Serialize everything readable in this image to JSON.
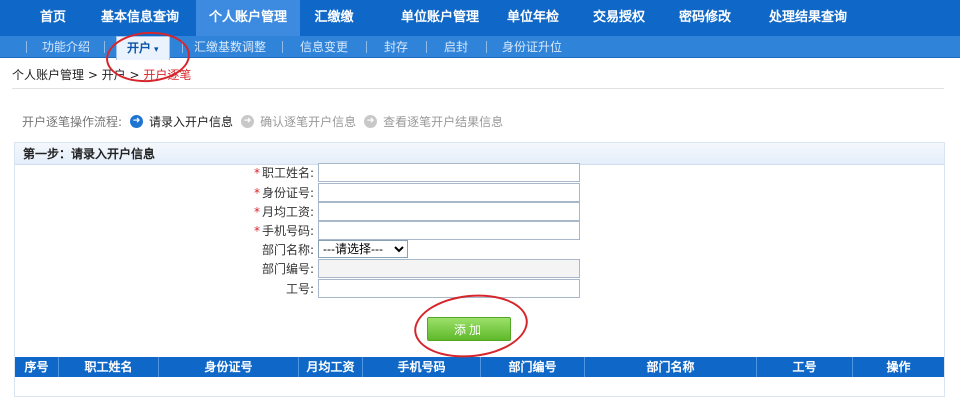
{
  "topnav": {
    "items": [
      "首页",
      "基本信息查询",
      "个人账户管理",
      "汇缴缴",
      "单位账户管理",
      "单位年检",
      "交易授权",
      "密码修改",
      "处理结果查询"
    ]
  },
  "subnav": {
    "items": [
      "功能介绍",
      "开户",
      "汇缴基数调整",
      "信息变更",
      "封存",
      "启封",
      "身份证升位"
    ],
    "active_caret": "▾"
  },
  "breadcrumb": {
    "part1": "个人账户管理 > 开户 > ",
    "current": "开户逐笔"
  },
  "flow": {
    "label": "开户逐笔操作流程:",
    "steps": [
      "请录入开户信息",
      "确认逐笔开户信息",
      "查看逐笔开户结果信息"
    ]
  },
  "form": {
    "title": "第一步：请录入开户信息",
    "required_mark": "*",
    "fields": {
      "name_label": "职工姓名:",
      "idcard_label": "身份证号:",
      "salary_label": "月均工资:",
      "phone_label": "手机号码:",
      "dept_name_label": "部门名称:",
      "dept_code_label": "部门编号:",
      "job_no_label": "工号:"
    },
    "dept_select_value": "---请选择---",
    "add_button": "添加"
  },
  "table": {
    "headers": [
      "序号",
      "职工姓名",
      "身份证号",
      "月均工资",
      "手机号码",
      "部门编号",
      "部门名称",
      "工号",
      "操作"
    ]
  },
  "colors": {
    "nav_blue": "#0f68c8",
    "subnav_blue": "#2f84da",
    "breadcrumb_current": "#d9252a",
    "add_button_green": "#5fb92a",
    "annotation_red": "#d6262b"
  }
}
